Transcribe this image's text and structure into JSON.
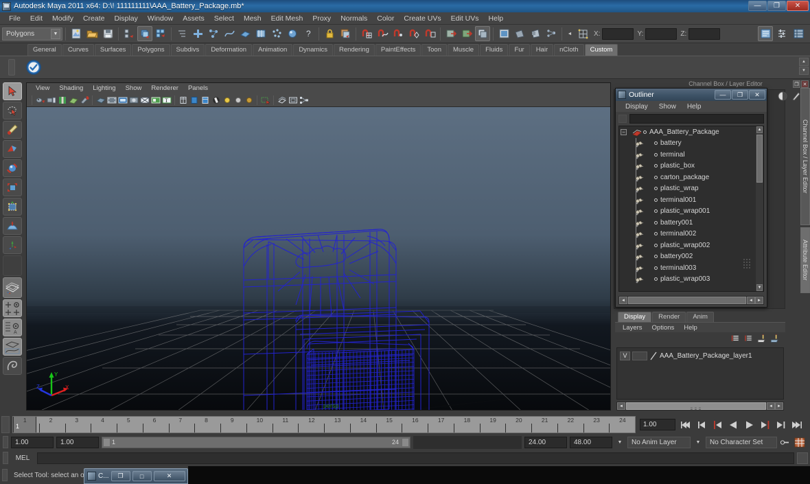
{
  "window": {
    "title": "Autodesk Maya 2011 x64: D:\\! 111111111\\AAA_Battery_Package.mb*",
    "app_icon": "maya-icon",
    "minimize": "—",
    "restore": "❐",
    "close": "✕"
  },
  "menubar": {
    "items": [
      "File",
      "Edit",
      "Modify",
      "Create",
      "Display",
      "Window",
      "Assets",
      "Select",
      "Mesh",
      "Edit Mesh",
      "Proxy",
      "Normals",
      "Color",
      "Create UVs",
      "Edit UVs",
      "Help"
    ]
  },
  "statusline": {
    "selection_mode": "Polygons",
    "x_label": "X:",
    "y_label": "Y:",
    "z_label": "Z:",
    "x_value": "",
    "y_value": "",
    "z_value": ""
  },
  "shelf": {
    "tabs": [
      "General",
      "Curves",
      "Surfaces",
      "Polygons",
      "Subdivs",
      "Deformation",
      "Animation",
      "Dynamics",
      "Rendering",
      "PaintEffects",
      "Toon",
      "Muscle",
      "Fluids",
      "Fur",
      "Hair",
      "nCloth",
      "Custom"
    ],
    "active_tab": "Custom",
    "items": [
      "check-mark-icon"
    ]
  },
  "toolbox": {
    "tools": [
      {
        "name": "select-tool",
        "selected": true
      },
      {
        "name": "lasso-select-tool",
        "selected": false
      },
      {
        "name": "paint-select-tool",
        "selected": false
      },
      {
        "name": "move-tool",
        "selected": false
      },
      {
        "name": "rotate-tool",
        "selected": false
      },
      {
        "name": "scale-tool",
        "selected": false
      },
      {
        "name": "universal-manipulator-tool",
        "selected": false
      },
      {
        "name": "soft-modification-tool",
        "selected": false
      },
      {
        "name": "show-manipulator-tool",
        "selected": false
      },
      {
        "name": "last-tool-used",
        "selected": false
      },
      {
        "name": "single-perspective-layout",
        "selected": false
      },
      {
        "name": "four-view-layout",
        "selected": false
      },
      {
        "name": "outliner-persp-layout",
        "selected": false
      },
      {
        "name": "persp-graph-layout",
        "selected": false
      },
      {
        "name": "hotbox-layout",
        "selected": false
      }
    ]
  },
  "viewport": {
    "menus": [
      "View",
      "Shading",
      "Lighting",
      "Show",
      "Renderer",
      "Panels"
    ],
    "label": "persp",
    "camera": "persp",
    "background_top": "#5b6d80",
    "background_bottom": "#0c0c0c",
    "wireframe_color": "#2020c8",
    "grid_color": "#8d8d8d",
    "axis_gizmo": {
      "x": "X",
      "y": "Y",
      "z": "Z",
      "x_color": "#d02020",
      "y_color": "#20c020",
      "z_color": "#2020d0"
    },
    "toolbar_icons": [
      "select-camera-icon",
      "camera-attributes-icon",
      "book-icon",
      "image-plane-icon",
      "grease-pencil-icon",
      "isolate-select-icon",
      "film-gate-icon",
      "resolution-gate-icon",
      "gate-mask-icon",
      "xray-icon",
      "exposure-icon",
      "text-overlay-icon",
      "wireframe-icon",
      "smooth-shade-all-icon",
      "smooth-shade-selected-icon",
      "hardware-texturing-icon",
      "use-default-light-icon",
      "use-all-lights-icon",
      "shadows-icon",
      "xray-joints-icon",
      "single-perspective-icon",
      "outliner-persp-icon",
      "hypergraph-icon"
    ]
  },
  "outliner": {
    "title": "Outliner",
    "icon": "outliner-icon",
    "minimize": "—",
    "restore": "❐",
    "close": "✕",
    "menus": [
      "Display",
      "Show",
      "Help"
    ],
    "search_value": "",
    "search_placeholder": "",
    "root": {
      "label": "AAA_Battery_Package",
      "expanded": true,
      "expander": "−"
    },
    "items": [
      "battery",
      "terminal",
      "plastic_box",
      "carton_package",
      "plastic_wrap",
      "terminal001",
      "plastic_wrap001",
      "battery001",
      "terminal002",
      "plastic_wrap002",
      "battery002",
      "terminal003",
      "plastic_wrap003"
    ]
  },
  "channel_box": {
    "title": "Channel Box / Layer Editor",
    "restore": "❐",
    "close": "✕"
  },
  "side_tabs": [
    {
      "label": "Channel Box / Layer Editor",
      "active": false
    },
    {
      "label": "Attribute Editor",
      "active": true
    }
  ],
  "layer_editor": {
    "tabs": [
      "Display",
      "Render",
      "Anim"
    ],
    "active_tab": "Display",
    "menus": [
      "Layers",
      "Options",
      "Help"
    ],
    "tool_icons": [
      "new-layer-icon",
      "new-layer-from-selected-icon",
      "load-layer-icon",
      "save-layer-icon"
    ],
    "layers": [
      {
        "visibility": "V",
        "playback": "",
        "name": "AAA_Battery_Package_layer1"
      }
    ]
  },
  "timeslider": {
    "ticks": [
      "1",
      "2",
      "3",
      "4",
      "5",
      "6",
      "7",
      "8",
      "9",
      "10",
      "11",
      "12",
      "13",
      "14",
      "15",
      "16",
      "17",
      "18",
      "19",
      "20",
      "21",
      "22",
      "23",
      "24"
    ],
    "current_frame_on_track": "1",
    "current_time": "1.00",
    "playback_buttons": [
      "go-to-start-icon",
      "step-back-keyframe-icon",
      "step-back-frame-icon",
      "play-backwards-icon",
      "play-forwards-icon",
      "step-forward-frame-icon",
      "step-forward-keyframe-icon",
      "go-to-end-icon"
    ]
  },
  "rangeslider": {
    "anim_start": "1.00",
    "range_start": "1.00",
    "bar_start_label": "1",
    "bar_end_label": "24",
    "range_end": "24.00",
    "anim_end": "48.00",
    "anim_layer": "No Anim Layer",
    "character_set": "No Character Set",
    "auto_key_icon": "auto-key-icon",
    "anim_prefs_icon": "animation-preferences-icon"
  },
  "command_line": {
    "language_label": "MEL",
    "value": "",
    "script_editor_icon": "script-editor-icon"
  },
  "helpline": {
    "text": "Select Tool: select an object"
  },
  "taskbar_window": {
    "icon": "maya-icon",
    "label": "C...",
    "restore": "❐",
    "maximize": "□",
    "close": "✕"
  }
}
